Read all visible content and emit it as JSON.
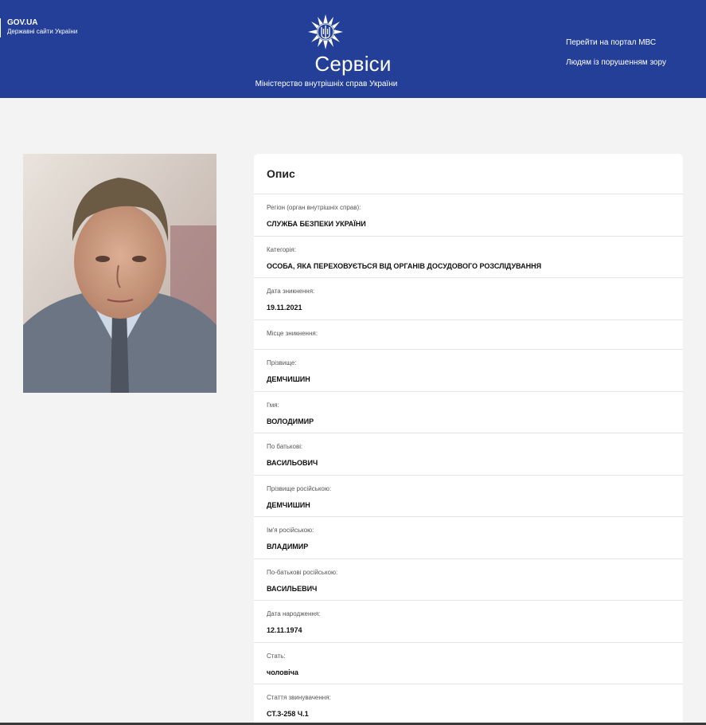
{
  "header": {
    "gov_title": "GOV.UA",
    "gov_subtitle": "Державні сайти України",
    "title": "Сервіси",
    "subtitle": "Міністерство внутрішніх справ України",
    "links": [
      "Перейти на портал МВС",
      "Людям із порушенням зору"
    ]
  },
  "card": {
    "title": "Опис",
    "fields": [
      {
        "label": "Регіон (орган внутрішніх справ):",
        "value": "СЛУЖБА БЕЗПЕКИ УКРАЇНИ"
      },
      {
        "label": "Категорія:",
        "value": "ОСОБА, ЯКА ПЕРЕХОВУЄТЬСЯ ВІД ОРГАНІВ ДОСУДОВОГО РОЗСЛІДУВАННЯ"
      },
      {
        "label": "Дата зникнення:",
        "value": "19.11.2021"
      },
      {
        "label": "Місце зникнення:",
        "value": ""
      },
      {
        "label": "Прізвище:",
        "value": "ДЕМЧИШИН"
      },
      {
        "label": "І'мя:",
        "value": "ВОЛОДИМИР"
      },
      {
        "label": "По батькові:",
        "value": "ВАСИЛЬОВИЧ"
      },
      {
        "label": "Прізвище російською:",
        "value": "ДЕМЧИШИН"
      },
      {
        "label": "Ім'я російською:",
        "value": "ВЛАДИМИР"
      },
      {
        "label": "По-батькові російською:",
        "value": "ВАСИЛЬЕВИЧ"
      },
      {
        "label": "Дата народження:",
        "value": "12.11.1974"
      },
      {
        "label": "Стать:",
        "value": "чоловіча"
      },
      {
        "label": "Стаття звинувачення:",
        "value": "СТ.3-258 Ч.1"
      }
    ]
  }
}
